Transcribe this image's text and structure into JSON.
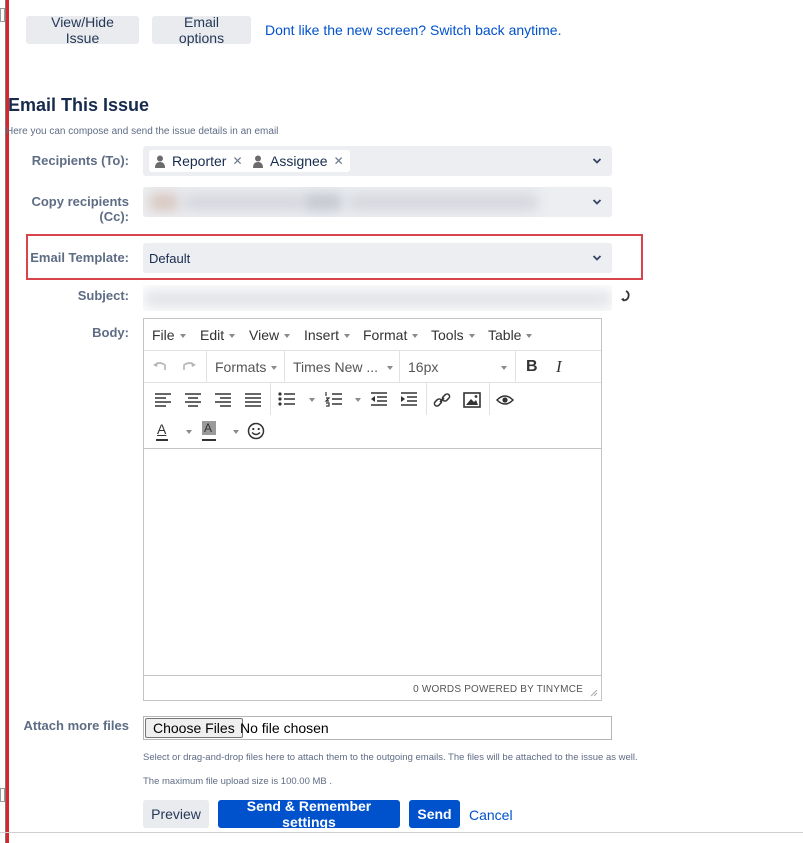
{
  "top_actions": {
    "view_hide": "View/Hide Issue",
    "email_options": "Email options",
    "switch_back_link": "Dont like the new screen? Switch back anytime."
  },
  "form": {
    "title": "Email This Issue",
    "hint": "Here you can compose and send the issue details in an email",
    "recipients_label": "Recipients (To):",
    "recipients": [
      {
        "name": "Reporter",
        "icon": "user-icon"
      },
      {
        "name": "Assignee",
        "icon": "user-icon"
      }
    ],
    "cc_label": "Copy recipients (Cc):",
    "template_label": "Email Template:",
    "template_value": "Default",
    "subject_label": "Subject:",
    "body_label": "Body:"
  },
  "editor": {
    "menu": [
      "File",
      "Edit",
      "View",
      "Insert",
      "Format",
      "Tools",
      "Table"
    ],
    "formats_label": "Formats",
    "font_family": "Times New ...",
    "font_size": "16px",
    "status": "0 WORDS POWERED BY TINYMCE"
  },
  "attach": {
    "label": "Attach more files",
    "choose_button": "Choose Files",
    "no_file": "No file chosen",
    "help": "Select or drag-and-drop files here to attach them to the outgoing emails. The files will be attached to the issue as well.",
    "max_size": "The maximum file upload size is 100.00 MB ."
  },
  "footer": {
    "preview": "Preview",
    "send_remember": "Send & Remember settings",
    "send": "Send",
    "cancel": "Cancel"
  },
  "colors": {
    "primary": "#0052cc",
    "highlight": "#d9444c",
    "field_bg": "#eceef2"
  }
}
